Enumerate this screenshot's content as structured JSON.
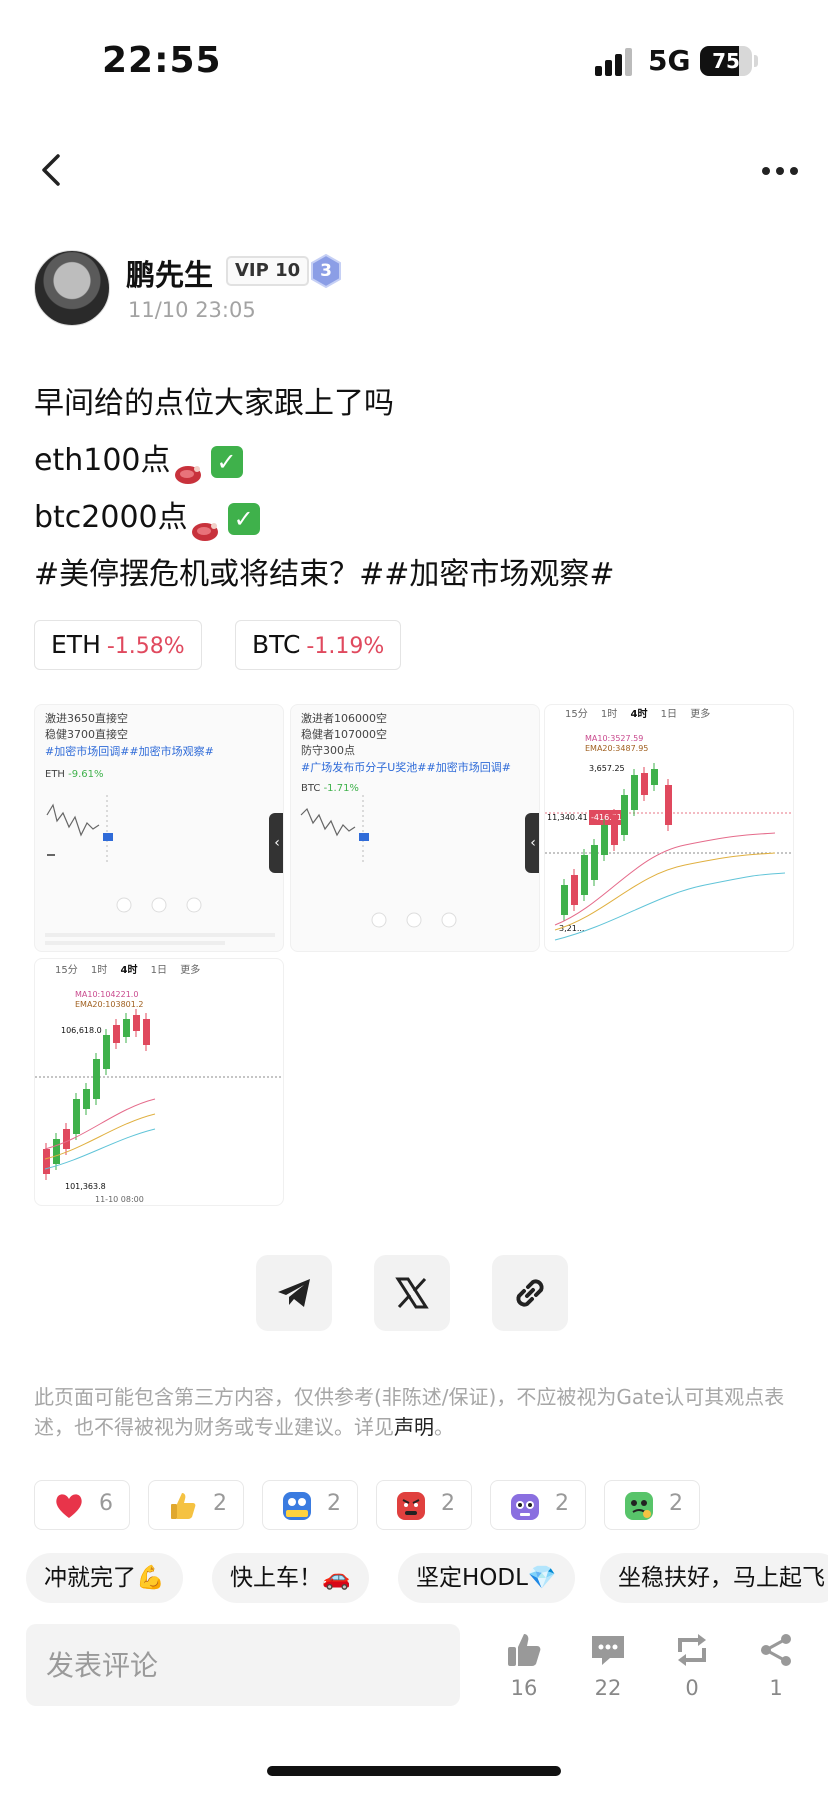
{
  "status_bar": {
    "time": "22:55",
    "network": "5G",
    "battery": "75",
    "battery_level": 0.75
  },
  "author": {
    "name": "鹏先生",
    "vip_badge": "VIP 10",
    "level_badge": "3",
    "post_time": "11/10 23:05"
  },
  "post": {
    "line1": "早间给的点位大家跟上了吗",
    "line2": "eth100点",
    "line3": "btc2000点",
    "hashtags": "#美停摆危机或将结束？##加密市场观察#"
  },
  "tickers": [
    {
      "symbol": "ETH",
      "change": "-1.58%"
    },
    {
      "symbol": "BTC",
      "change": "-1.19%"
    }
  ],
  "images": {
    "img1": {
      "lines": [
        "激进3650直接空",
        "稳健3700直接空"
      ],
      "tag": "#加密市场回调##加密市场观察#",
      "coin": "ETH",
      "coin_change": "-9.61%"
    },
    "img2": {
      "lines": [
        "激进者106000空",
        "稳健者107000空",
        "防守300点"
      ],
      "tag": "#广场发布币分子U奖池##加密市场回调#",
      "coin": "BTC",
      "coin_change": "-1.71%"
    },
    "img3": {
      "tabs": [
        "15分",
        "1时",
        "4时",
        "1日",
        "更多"
      ],
      "ma_label": "MA10:3527.59",
      "ema_label": "EMA20:3487.95",
      "high": "3,657.25",
      "price_tag": "-416.01",
      "left_price": "11,340.41",
      "low": "3,21..."
    },
    "img4": {
      "tabs": [
        "15分",
        "1时",
        "4时",
        "1日",
        "更多"
      ],
      "ma_label": "MA10:104221.0",
      "ema_label": "EMA20:103801.2",
      "high": "106,618.0",
      "low": "101,363.8",
      "date": "11-10 08:00"
    }
  },
  "share": {
    "telegram_icon": "telegram-icon",
    "x_icon": "x-icon",
    "link_icon": "link-icon"
  },
  "disclaimer": {
    "text": "此页面可能包含第三方内容，仅供参考(非陈述/保证)，不应被视为Gate认可其观点表述，也不得被视为财务或专业建议。详见",
    "link": "声明",
    "end": "。"
  },
  "reactions": [
    {
      "icon": "heart-icon",
      "count": "6"
    },
    {
      "icon": "thumbs-up-icon",
      "count": "2"
    },
    {
      "icon": "hodl-icon",
      "count": "2"
    },
    {
      "icon": "angry-face-icon",
      "count": "2"
    },
    {
      "icon": "robot-face-icon",
      "count": "2"
    },
    {
      "icon": "sick-face-icon",
      "count": "2"
    }
  ],
  "chips": [
    "冲就完了💪",
    "快上车！🚗",
    "坚定HODL💎",
    "坐稳扶好，马上起飞"
  ],
  "bottom_bar": {
    "comment_placeholder": "发表评论",
    "likes": "16",
    "comments": "22",
    "reposts": "0",
    "shares": "1"
  },
  "colors": {
    "accent": "#2f6bd8",
    "down": "#e0495e",
    "up": "#3fb14b"
  }
}
